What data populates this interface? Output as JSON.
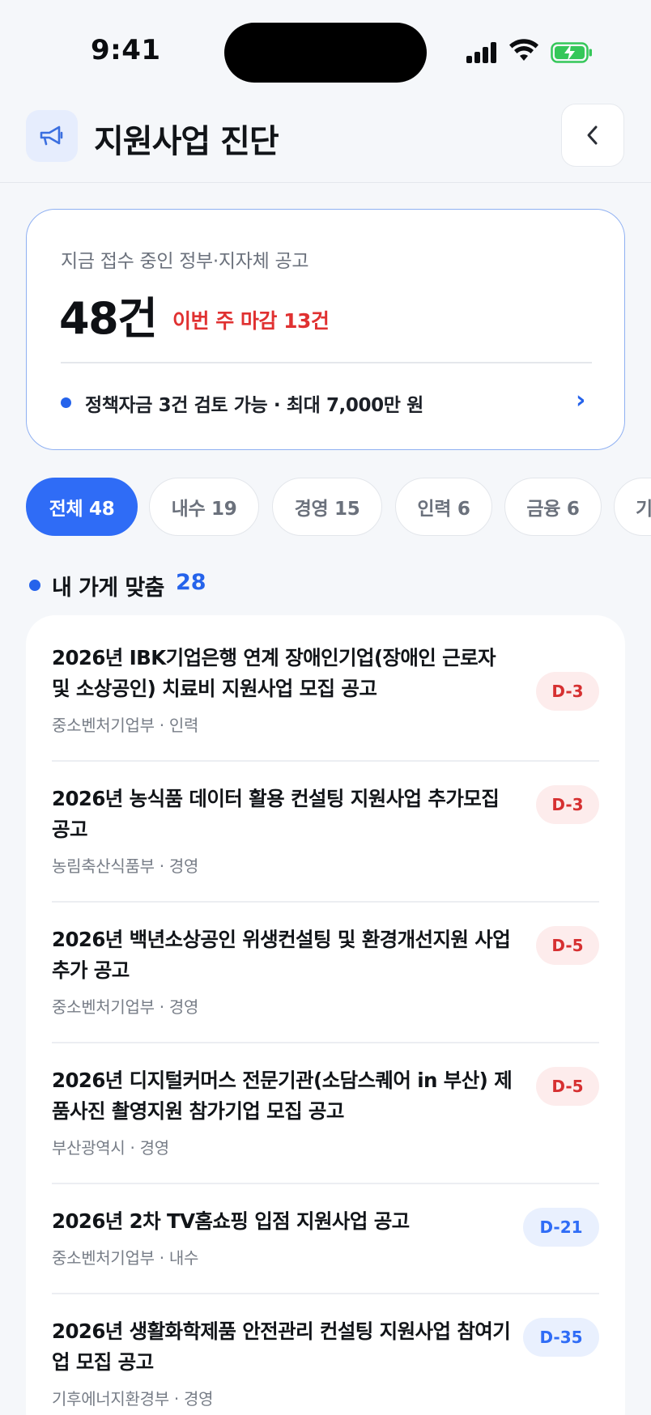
{
  "status_bar": {
    "time": "9:41"
  },
  "header": {
    "title": "지원사업 진단"
  },
  "summary": {
    "label": "지금 접수 중인 정부·지자체 공고",
    "count": "48건",
    "deadline": "이번 주 마감 13건",
    "policy": "정책자금 3건 검토 가능 · 최대 7,000만 원",
    "arrow": "›"
  },
  "chips": [
    {
      "label": "전체 48",
      "active": true
    },
    {
      "label": "내수 19",
      "active": false
    },
    {
      "label": "경영 15",
      "active": false
    },
    {
      "label": "인력 6",
      "active": false
    },
    {
      "label": "금융 6",
      "active": false
    },
    {
      "label": "기",
      "active": false
    }
  ],
  "section": {
    "title": "내 가게 맞춤",
    "count": "28"
  },
  "items": [
    {
      "title": "2026년 IBK기업은행 연계 장애인기업(장애인 근로자 및 소상공인) 치료비 지원사업 모집 공고",
      "meta": "중소벤처기업부 · 인력",
      "badge": "D-3",
      "badge_color": "red"
    },
    {
      "title": "2026년 농식품 데이터 활용 컨설팅 지원사업 추가모집 공고",
      "meta": "농림축산식품부 · 경영",
      "badge": "D-3",
      "badge_color": "red"
    },
    {
      "title": "2026년 백년소상공인 위생컨설팅 및 환경개선지원 사업 추가 공고",
      "meta": "중소벤처기업부 · 경영",
      "badge": "D-5",
      "badge_color": "red"
    },
    {
      "title": "2026년 디지털커머스 전문기관(소담스퀘어 in 부산) 제품사진 촬영지원 참가기업 모집 공고",
      "meta": "부산광역시 · 경영",
      "badge": "D-5",
      "badge_color": "red"
    },
    {
      "title": "2026년 2차 TV홈쇼핑 입점 지원사업 공고",
      "meta": "중소벤처기업부 · 내수",
      "badge": "D-21",
      "badge_color": "blue"
    },
    {
      "title": "2026년 생활화학제품 안전관리 컨설팅 지원사업 참여기업 모집 공고",
      "meta": "기후에너지환경부 · 경영",
      "badge": "D-35",
      "badge_color": "blue"
    }
  ]
}
